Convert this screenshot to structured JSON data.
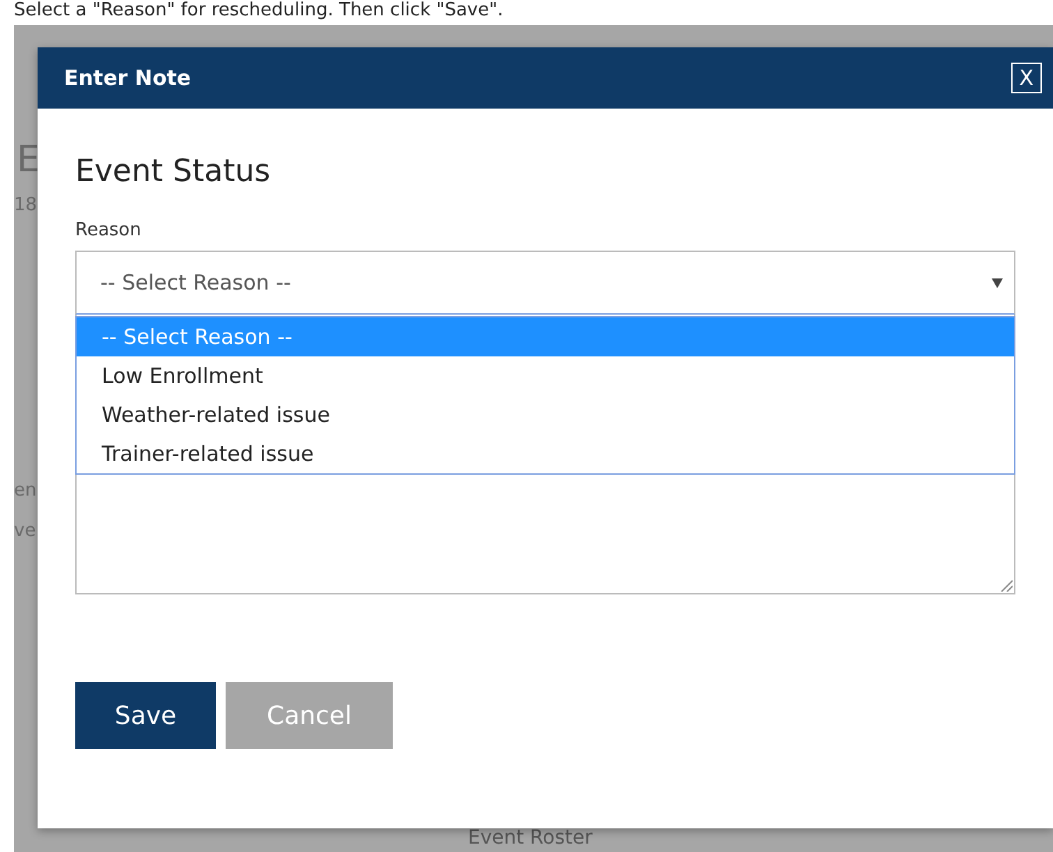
{
  "instruction": "Select a \"Reason\" for rescheduling. Then click \"Save\".",
  "background_fragments": [
    {
      "text": "E",
      "kind": "heading"
    },
    {
      "text": "18",
      "kind": "small"
    },
    {
      "text": "en",
      "kind": "small"
    },
    {
      "text": "ve",
      "kind": "small"
    },
    {
      "text": "Event Roster",
      "kind": "footer"
    }
  ],
  "dialog": {
    "title": "Enter Note",
    "close": "X",
    "heading": "Event Status",
    "field_label": "Reason",
    "select_value": "-- Select Reason --",
    "expanded": true,
    "options": [
      {
        "label": "-- Select Reason --",
        "selected": true
      },
      {
        "label": "Low Enrollment",
        "selected": false
      },
      {
        "label": "Weather-related issue",
        "selected": false
      },
      {
        "label": "Trainer-related issue",
        "selected": false
      }
    ],
    "buttons": [
      {
        "label": "Save",
        "kind": "primary"
      },
      {
        "label": "Cancel",
        "kind": "secondary"
      }
    ]
  }
}
